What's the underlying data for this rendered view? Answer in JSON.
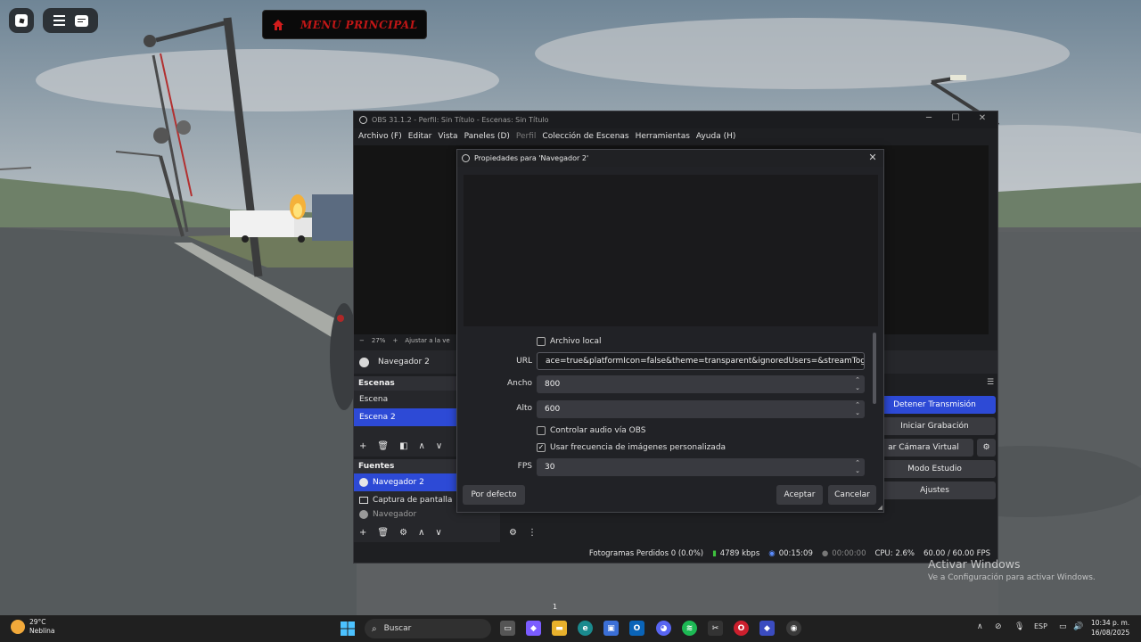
{
  "roblox": {
    "menu_principal": "MENU PRINCIPAL",
    "icons": [
      "roblox-logo",
      "hamburger-menu",
      "chat-bubble",
      "home-icon"
    ]
  },
  "obs": {
    "title": "OBS 31.1.2 - Perfil: Sin Título - Escenas: Sin Título",
    "menu": [
      "Archivo (F)",
      "Editar",
      "Vista",
      "Paneles (D)",
      "Perfil",
      "Colección de Escenas",
      "Herramientas",
      "Ayuda (H)"
    ],
    "preview_bar": {
      "zoom": "27%",
      "fit": "Ajustar a la ve"
    },
    "selected_source": "Navegador 2",
    "scenes": {
      "title": "Escenas",
      "items": [
        "Escena",
        "Escena 2"
      ],
      "selected": "Escena 2"
    },
    "sources": {
      "title": "Fuentes",
      "items": [
        "Navegador 2",
        "Captura de pantalla",
        "Navegador"
      ],
      "selected": "Navegador 2"
    },
    "controls": {
      "stop_stream": "Detener Transmisión",
      "start_recording": "Iniciar Grabación",
      "virtual_camera": "ar Cámara Virtual",
      "studio_mode": "Modo Estudio",
      "settings": "Ajustes"
    },
    "status": {
      "dropped_frames": "Fotogramas Perdidos 0 (0.0%)",
      "bitrate": "4789 kbps",
      "stream_time": "00:15:09",
      "record_time": "00:00:00",
      "cpu": "CPU: 2.6%",
      "fps": "60.00 / 60.00 FPS"
    },
    "colors": {
      "accent": "#2d4ad6",
      "bg": "#1e1f22",
      "dock": "#26272b"
    }
  },
  "dialog": {
    "title": "Propiedades para 'Navegador 2'",
    "local_file_label": "Archivo local",
    "local_file_checked": false,
    "url_label": "URL",
    "url_value": "ace=true&platformIcon=false&theme=transparent&ignoredUsers=&streamTogether=true",
    "width_label": "Ancho",
    "width_value": "800",
    "height_label": "Alto",
    "height_value": "600",
    "audio_label": "Controlar audio vía OBS",
    "audio_checked": false,
    "custom_fps_label": "Usar frecuencia de imágenes personalizada",
    "custom_fps_checked": true,
    "fps_label": "FPS",
    "fps_value": "30",
    "defaults_button": "Por defecto",
    "ok_button": "Aceptar",
    "cancel_button": "Cancelar"
  },
  "watermark": {
    "title": "Activar Windows",
    "subtitle": "Ve a Configuración para activar Windows."
  },
  "page_indicator": "1",
  "taskbar": {
    "weather_temp": "29°C",
    "weather_desc": "Neblina",
    "search_placeholder": "Buscar",
    "language": "ESP",
    "time": "10:34 p. m.",
    "date": "16/08/2025"
  }
}
